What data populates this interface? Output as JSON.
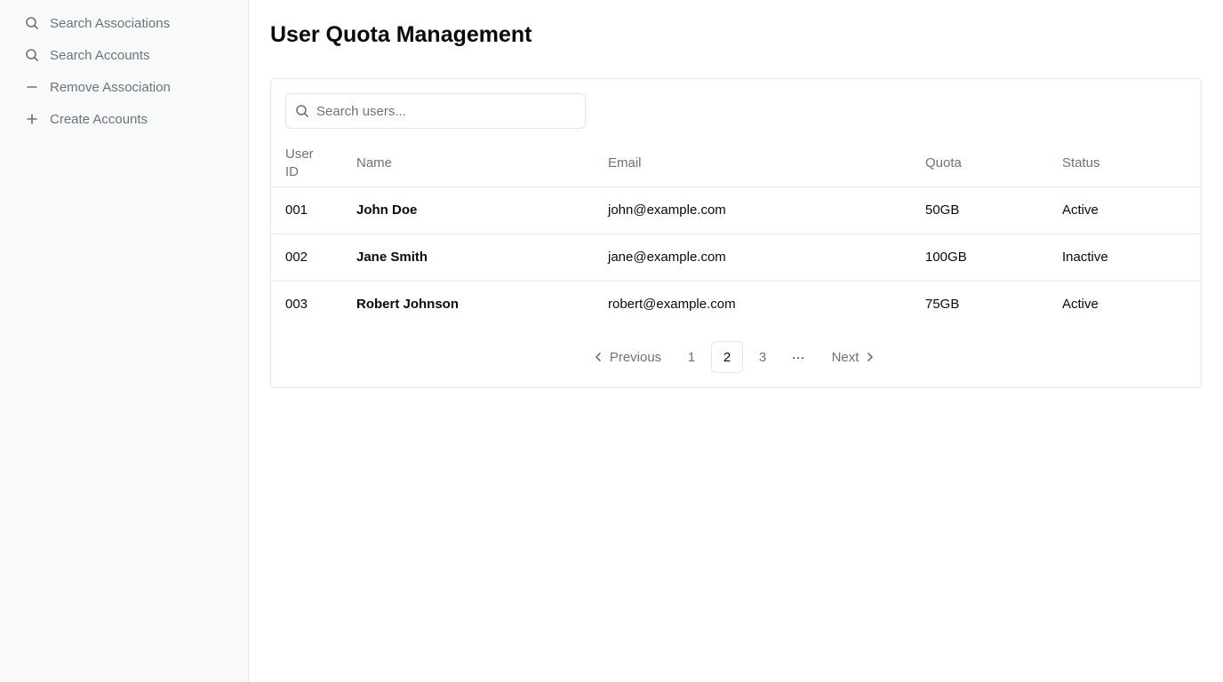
{
  "sidebar": {
    "items": [
      {
        "label": "Search Associations",
        "icon": "search-icon"
      },
      {
        "label": "Search Accounts",
        "icon": "search-icon"
      },
      {
        "label": "Remove Association",
        "icon": "minus-icon"
      },
      {
        "label": "Create Accounts",
        "icon": "plus-icon"
      }
    ]
  },
  "page": {
    "title": "User Quota Management"
  },
  "search": {
    "placeholder": "Search users..."
  },
  "table": {
    "headers": {
      "id": "User ID",
      "name": "Name",
      "email": "Email",
      "quota": "Quota",
      "status": "Status"
    },
    "rows": [
      {
        "id": "001",
        "name": "John Doe",
        "email": "john@example.com",
        "quota": "50GB",
        "status": "Active"
      },
      {
        "id": "002",
        "name": "Jane Smith",
        "email": "jane@example.com",
        "quota": "100GB",
        "status": "Inactive"
      },
      {
        "id": "003",
        "name": "Robert Johnson",
        "email": "robert@example.com",
        "quota": "75GB",
        "status": "Active"
      }
    ]
  },
  "pagination": {
    "previous": "Previous",
    "next": "Next",
    "pages": [
      "1",
      "2",
      "3"
    ],
    "current": "2",
    "ellipsis": "···"
  }
}
